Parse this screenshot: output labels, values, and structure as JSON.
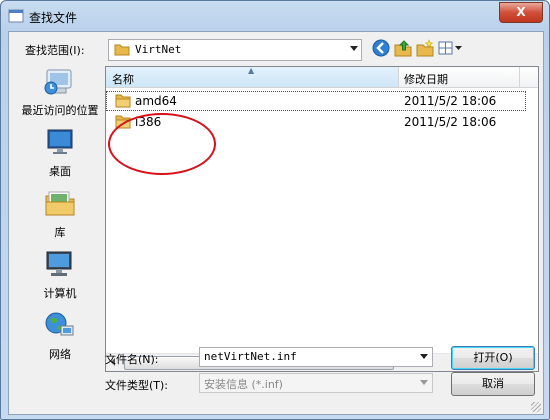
{
  "window": {
    "title": "查找文件",
    "close_label": "X"
  },
  "lookin": {
    "label": "查找范围(I):",
    "value": "VirtNet"
  },
  "toolbar": {
    "icons": [
      "back-icon",
      "up-folder-icon",
      "new-folder-icon",
      "view-menu-icon"
    ]
  },
  "places": [
    {
      "label": "最近访问的位置",
      "icon": "recent-places-icon"
    },
    {
      "label": "桌面",
      "icon": "desktop-icon"
    },
    {
      "label": "库",
      "icon": "libraries-icon"
    },
    {
      "label": "计算机",
      "icon": "computer-icon"
    },
    {
      "label": "网络",
      "icon": "network-icon"
    }
  ],
  "filelist": {
    "columns": [
      "名称",
      "修改日期"
    ],
    "rows": [
      {
        "name": "amd64",
        "date": "2011/5/2 18:06"
      },
      {
        "name": "i386",
        "date": "2011/5/2 18:06"
      }
    ]
  },
  "filename": {
    "label": "文件名(N):",
    "value": "netVirtNet.inf"
  },
  "filetype": {
    "label": "文件类型(T):",
    "value": "安装信息 (*.inf)"
  },
  "buttons": {
    "open": "打开(O)",
    "cancel": "取消"
  },
  "colors": {
    "highlight_circle": "#d8101a",
    "folder": "#e8b84a"
  }
}
